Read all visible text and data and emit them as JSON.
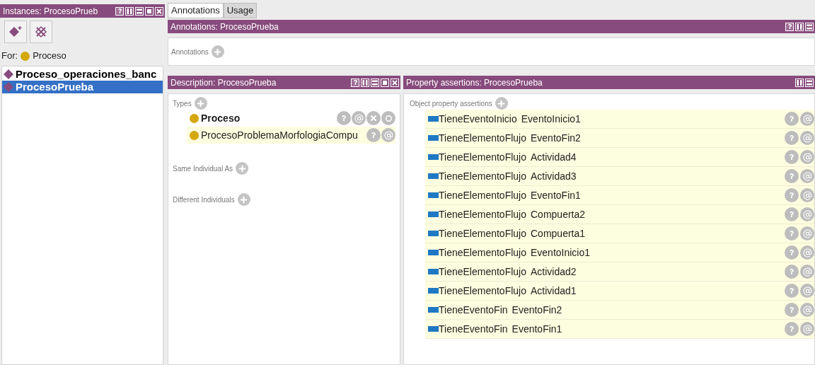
{
  "instances_panel": {
    "title": "Instances: ProcesoPrueb",
    "header_buttons": [
      {
        "kind": "help"
      },
      {
        "kind": "split_v"
      },
      {
        "kind": "split_h"
      },
      {
        "kind": "maximize"
      },
      {
        "kind": "close"
      }
    ],
    "toolbar": [
      {
        "kind": "add_individual"
      },
      {
        "kind": "delete_individual"
      }
    ],
    "for_label": "For:",
    "for_class": "Proceso",
    "items": [
      {
        "label": "Proceso_operaciones_banc",
        "selected": false
      },
      {
        "label": "ProcesoPrueba",
        "selected": true
      }
    ]
  },
  "tabs": [
    {
      "label": "Annotations",
      "selected": true
    },
    {
      "label": "Usage",
      "selected": false
    }
  ],
  "annotations_panel": {
    "title": "Annotations: ProcesoPrueba",
    "header_buttons": [
      {
        "kind": "help"
      },
      {
        "kind": "split_v"
      },
      {
        "kind": "split_h"
      }
    ],
    "section": "Annotations"
  },
  "description_panel": {
    "title": "Description: ProcesoPrueba",
    "header_buttons": [
      {
        "kind": "help"
      },
      {
        "kind": "split_v"
      },
      {
        "kind": "split_h"
      },
      {
        "kind": "maximize"
      },
      {
        "kind": "close"
      }
    ],
    "sections": [
      {
        "label": "Types",
        "items": [
          {
            "label": "Proceso",
            "bold": true,
            "highlighted": false,
            "actions": [
              {
                "kind": "help"
              },
              {
                "kind": "annotate"
              },
              {
                "kind": "delete"
              },
              {
                "kind": "edit"
              }
            ]
          },
          {
            "label": "ProcesoProblemaMorfologiaCompu",
            "bold": false,
            "highlighted": true,
            "actions": [
              {
                "kind": "help"
              },
              {
                "kind": "annotate"
              }
            ]
          }
        ]
      },
      {
        "label": "Same Individual As"
      },
      {
        "label": "Different Individuals"
      }
    ]
  },
  "property_panel": {
    "title": "Property assertions: ProcesoPrueba",
    "header_buttons": [
      {
        "kind": "split_v"
      },
      {
        "kind": "split_h"
      }
    ],
    "section": "Object property assertions",
    "rows": [
      {
        "property": "TieneEventoInicio",
        "value": "EventoInicio1"
      },
      {
        "property": "TieneElementoFlujo",
        "value": "EventoFin2"
      },
      {
        "property": "TieneElementoFlujo",
        "value": "Actividad4"
      },
      {
        "property": "TieneElementoFlujo",
        "value": "Actividad3"
      },
      {
        "property": "TieneElementoFlujo",
        "value": "EventoFin1"
      },
      {
        "property": "TieneElementoFlujo",
        "value": "Compuerta2"
      },
      {
        "property": "TieneElementoFlujo",
        "value": "Compuerta1"
      },
      {
        "property": "TieneElementoFlujo",
        "value": "EventoInicio1"
      },
      {
        "property": "TieneElementoFlujo",
        "value": "Actividad2"
      },
      {
        "property": "TieneElementoFlujo",
        "value": "Actividad1"
      },
      {
        "property": "TieneEventoFin",
        "value": "EventoFin2"
      },
      {
        "property": "TieneEventoFin",
        "value": "EventoFin1"
      }
    ]
  }
}
